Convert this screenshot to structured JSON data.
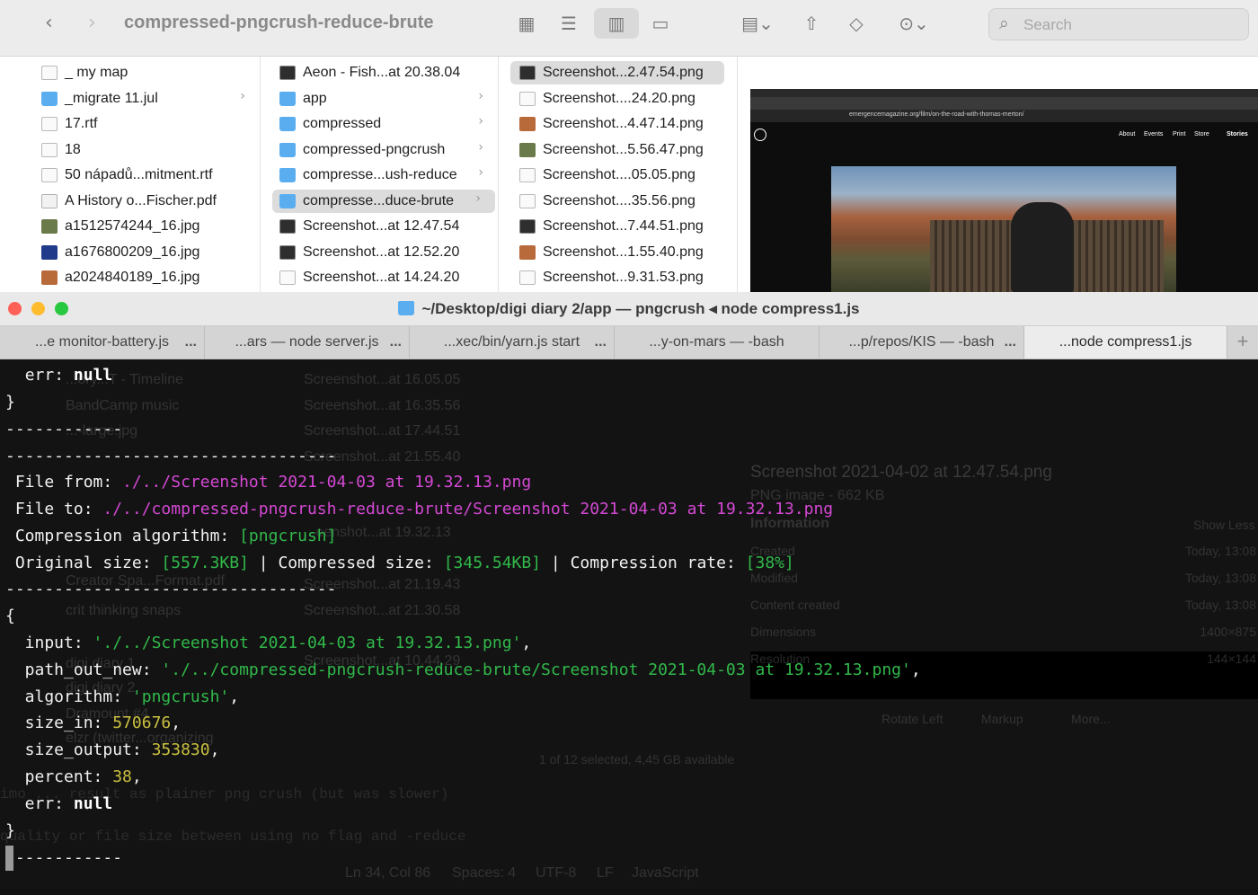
{
  "finder": {
    "title": "compressed-pngcrush-reduce-brute",
    "search_placeholder": "Search",
    "icons": {
      "back": "chevron-left-icon",
      "forward": "chevron-right-icon",
      "grid": "grid-view-icon",
      "list": "list-view-icon",
      "columns": "column-view-icon",
      "gallery": "gallery-view-icon",
      "group": "group-icon",
      "share": "share-icon",
      "tag": "tag-icon",
      "more": "ellipsis-icon",
      "search": "search-icon"
    },
    "col1": [
      {
        "label": "_ my map",
        "icon": "file",
        "chev": false
      },
      {
        "label": "_migrate 11.jul",
        "icon": "folder",
        "chev": true
      },
      {
        "label": "17.rtf",
        "icon": "file",
        "chev": false
      },
      {
        "label": "18",
        "icon": "file",
        "chev": false
      },
      {
        "label": "50 nápadů...mitment.rtf",
        "icon": "file",
        "chev": false
      },
      {
        "label": "A History o...Fischer.pdf",
        "icon": "pdf",
        "chev": false
      },
      {
        "label": "a1512574244_16.jpg",
        "icon": "img1",
        "chev": false
      },
      {
        "label": "a1676800209_16.jpg",
        "icon": "img2",
        "chev": false
      },
      {
        "label": "a2024840189_16.jpg",
        "icon": "img3",
        "chev": false
      }
    ],
    "col2": [
      {
        "label": "Aeon - Fish...at 20.38.04",
        "icon": "shot",
        "chev": false,
        "sel": false
      },
      {
        "label": "app",
        "icon": "folder",
        "chev": true,
        "sel": false
      },
      {
        "label": "compressed",
        "icon": "folder",
        "chev": true,
        "sel": false
      },
      {
        "label": "compressed-pngcrush",
        "icon": "folder",
        "chev": true,
        "sel": false
      },
      {
        "label": "compresse...ush-reduce",
        "icon": "folder",
        "chev": true,
        "sel": false
      },
      {
        "label": "compresse...duce-brute",
        "icon": "folder",
        "chev": true,
        "sel": true
      },
      {
        "label": "Screenshot...at 12.47.54",
        "icon": "shot",
        "chev": false,
        "sel": false
      },
      {
        "label": "Screenshot...at 12.52.20",
        "icon": "shot",
        "chev": false,
        "sel": false
      },
      {
        "label": "Screenshot...at 14.24.20",
        "icon": "file",
        "chev": false,
        "sel": false
      }
    ],
    "col3": [
      {
        "label": "Screenshot...2.47.54.png",
        "icon": "shot",
        "sel": true
      },
      {
        "label": "Screenshot....24.20.png",
        "icon": "file",
        "sel": false
      },
      {
        "label": "Screenshot...4.47.14.png",
        "icon": "img3",
        "sel": false
      },
      {
        "label": "Screenshot...5.56.47.png",
        "icon": "img1",
        "sel": false
      },
      {
        "label": "Screenshot....05.05.png",
        "icon": "file",
        "sel": false
      },
      {
        "label": "Screenshot....35.56.png",
        "icon": "file",
        "sel": false
      },
      {
        "label": "Screenshot...7.44.51.png",
        "icon": "shot",
        "sel": false
      },
      {
        "label": "Screenshot...1.55.40.png",
        "icon": "img3",
        "sel": false
      },
      {
        "label": "Screenshot...9.31.53.png",
        "icon": "file",
        "sel": false
      }
    ],
    "preview": {
      "url": "emergencemagazine.org/film/on-the-road-with-thomas-merton/",
      "nav": [
        "About",
        "Events",
        "Print",
        "Store",
        "Stories"
      ]
    }
  },
  "terminal": {
    "title": "~/Desktop/digi diary 2/app — pngcrush ◂ node compress1.js",
    "tabs": [
      {
        "label": "...e monitor-battery.js",
        "dots": "...",
        "active": false
      },
      {
        "label": "...ars — node server.js",
        "dots": "...",
        "active": false
      },
      {
        "label": "...xec/bin/yarn.js start",
        "dots": "...",
        "active": false
      },
      {
        "label": "...y-on-mars — -bash",
        "dots": "",
        "active": false
      },
      {
        "label": "...p/repos/KIS — -bash",
        "dots": "...",
        "active": false
      },
      {
        "label": "...node compress1.js",
        "dots": "",
        "active": true
      }
    ],
    "plus": "+",
    "output": {
      "err_key": "err:",
      "null_val": "null",
      "close_brace": "}",
      "open_brace": "{",
      "short_dashes": "------------",
      "long_dashes": "----------------------------------",
      "file_from_label": " File from: ",
      "file_from_val": "./../Screenshot 2021-04-03 at 19.32.13.png",
      "file_to_label": " File to: ",
      "file_to_val": "./../compressed-pngcrush-reduce-brute/Screenshot 2021-04-03 at 19.32.13.png",
      "algo_label": " Compression algorithm: ",
      "algo_val": "[pngcrush]",
      "orig_label": " Original size: ",
      "orig_val": "[557.3KB]",
      "comp_label": " | Compressed size: ",
      "comp_val": "[345.54KB]",
      "rate_label": " | Compression rate: ",
      "rate_val": "[38%]",
      "input_key": "  input: ",
      "input_val": "'./../Screenshot 2021-04-03 at 19.32.13.png'",
      "path_key": "  path_out_new: ",
      "path_val": "'./../compressed-pngcrush-reduce-brute/Screenshot 2021-04-03 at 19.32.13.png'",
      "algorithm_key": "  algorithm: ",
      "algorithm_val": "'pngcrush'",
      "size_in_key": "  size_in: ",
      "size_in_val": "570676",
      "size_out_key": "  size_output: ",
      "size_out_val": "353830",
      "percent_key": "  percent: ",
      "percent_val": "38",
      "comma": ",",
      "err2_key": "  err: "
    }
  },
  "ghost": {
    "finder_rows": [
      "...ory...T - Timeline",
      "BandCamp music",
      "...-large.jpg",
      "Creator Spa...Format.pdf",
      "crit thinking snaps",
      "digi diary 1",
      "digi diary 2",
      "Dramount #4",
      "elzr (twitter...organizing"
    ],
    "finder_rows2": [
      "Screenshot...at 16.05.05",
      "Screenshot...at 16.35.56",
      "Screenshot...at 17.44.51",
      "Screenshot...at 21.55.40",
      "...eenshot...at 19.32.13",
      "Screenshot...at 21.19.43",
      "Screenshot...at 21.30.58",
      "Screenshot...at 10.44.29"
    ],
    "preview_title": "Screenshot 2021-04-02 at 12.47.54.png",
    "preview_sub": "PNG image - 662 KB",
    "info_header": "Information",
    "show_less": "Show Less",
    "info": [
      {
        "k": "Created",
        "v": "Today, 13:08"
      },
      {
        "k": "Modified",
        "v": "Today, 13:08"
      },
      {
        "k": "Content created",
        "v": "Today, 13:08"
      },
      {
        "k": "Dimensions",
        "v": "1400×875"
      },
      {
        "k": "Resolution",
        "v": "144×144"
      }
    ],
    "actions": [
      "Rotate Left",
      "Markup",
      "More..."
    ],
    "status": "1 of 12 selected, 4,45 GB available",
    "editor_line1": "imo ... result as plainer png crush (but was slower)",
    "editor_line2": "quality or file size between using no flag and -reduce",
    "statusbar": [
      "Ln 34, Col 86",
      "Spaces: 4",
      "UTF-8",
      "LF",
      "JavaScript"
    ]
  }
}
